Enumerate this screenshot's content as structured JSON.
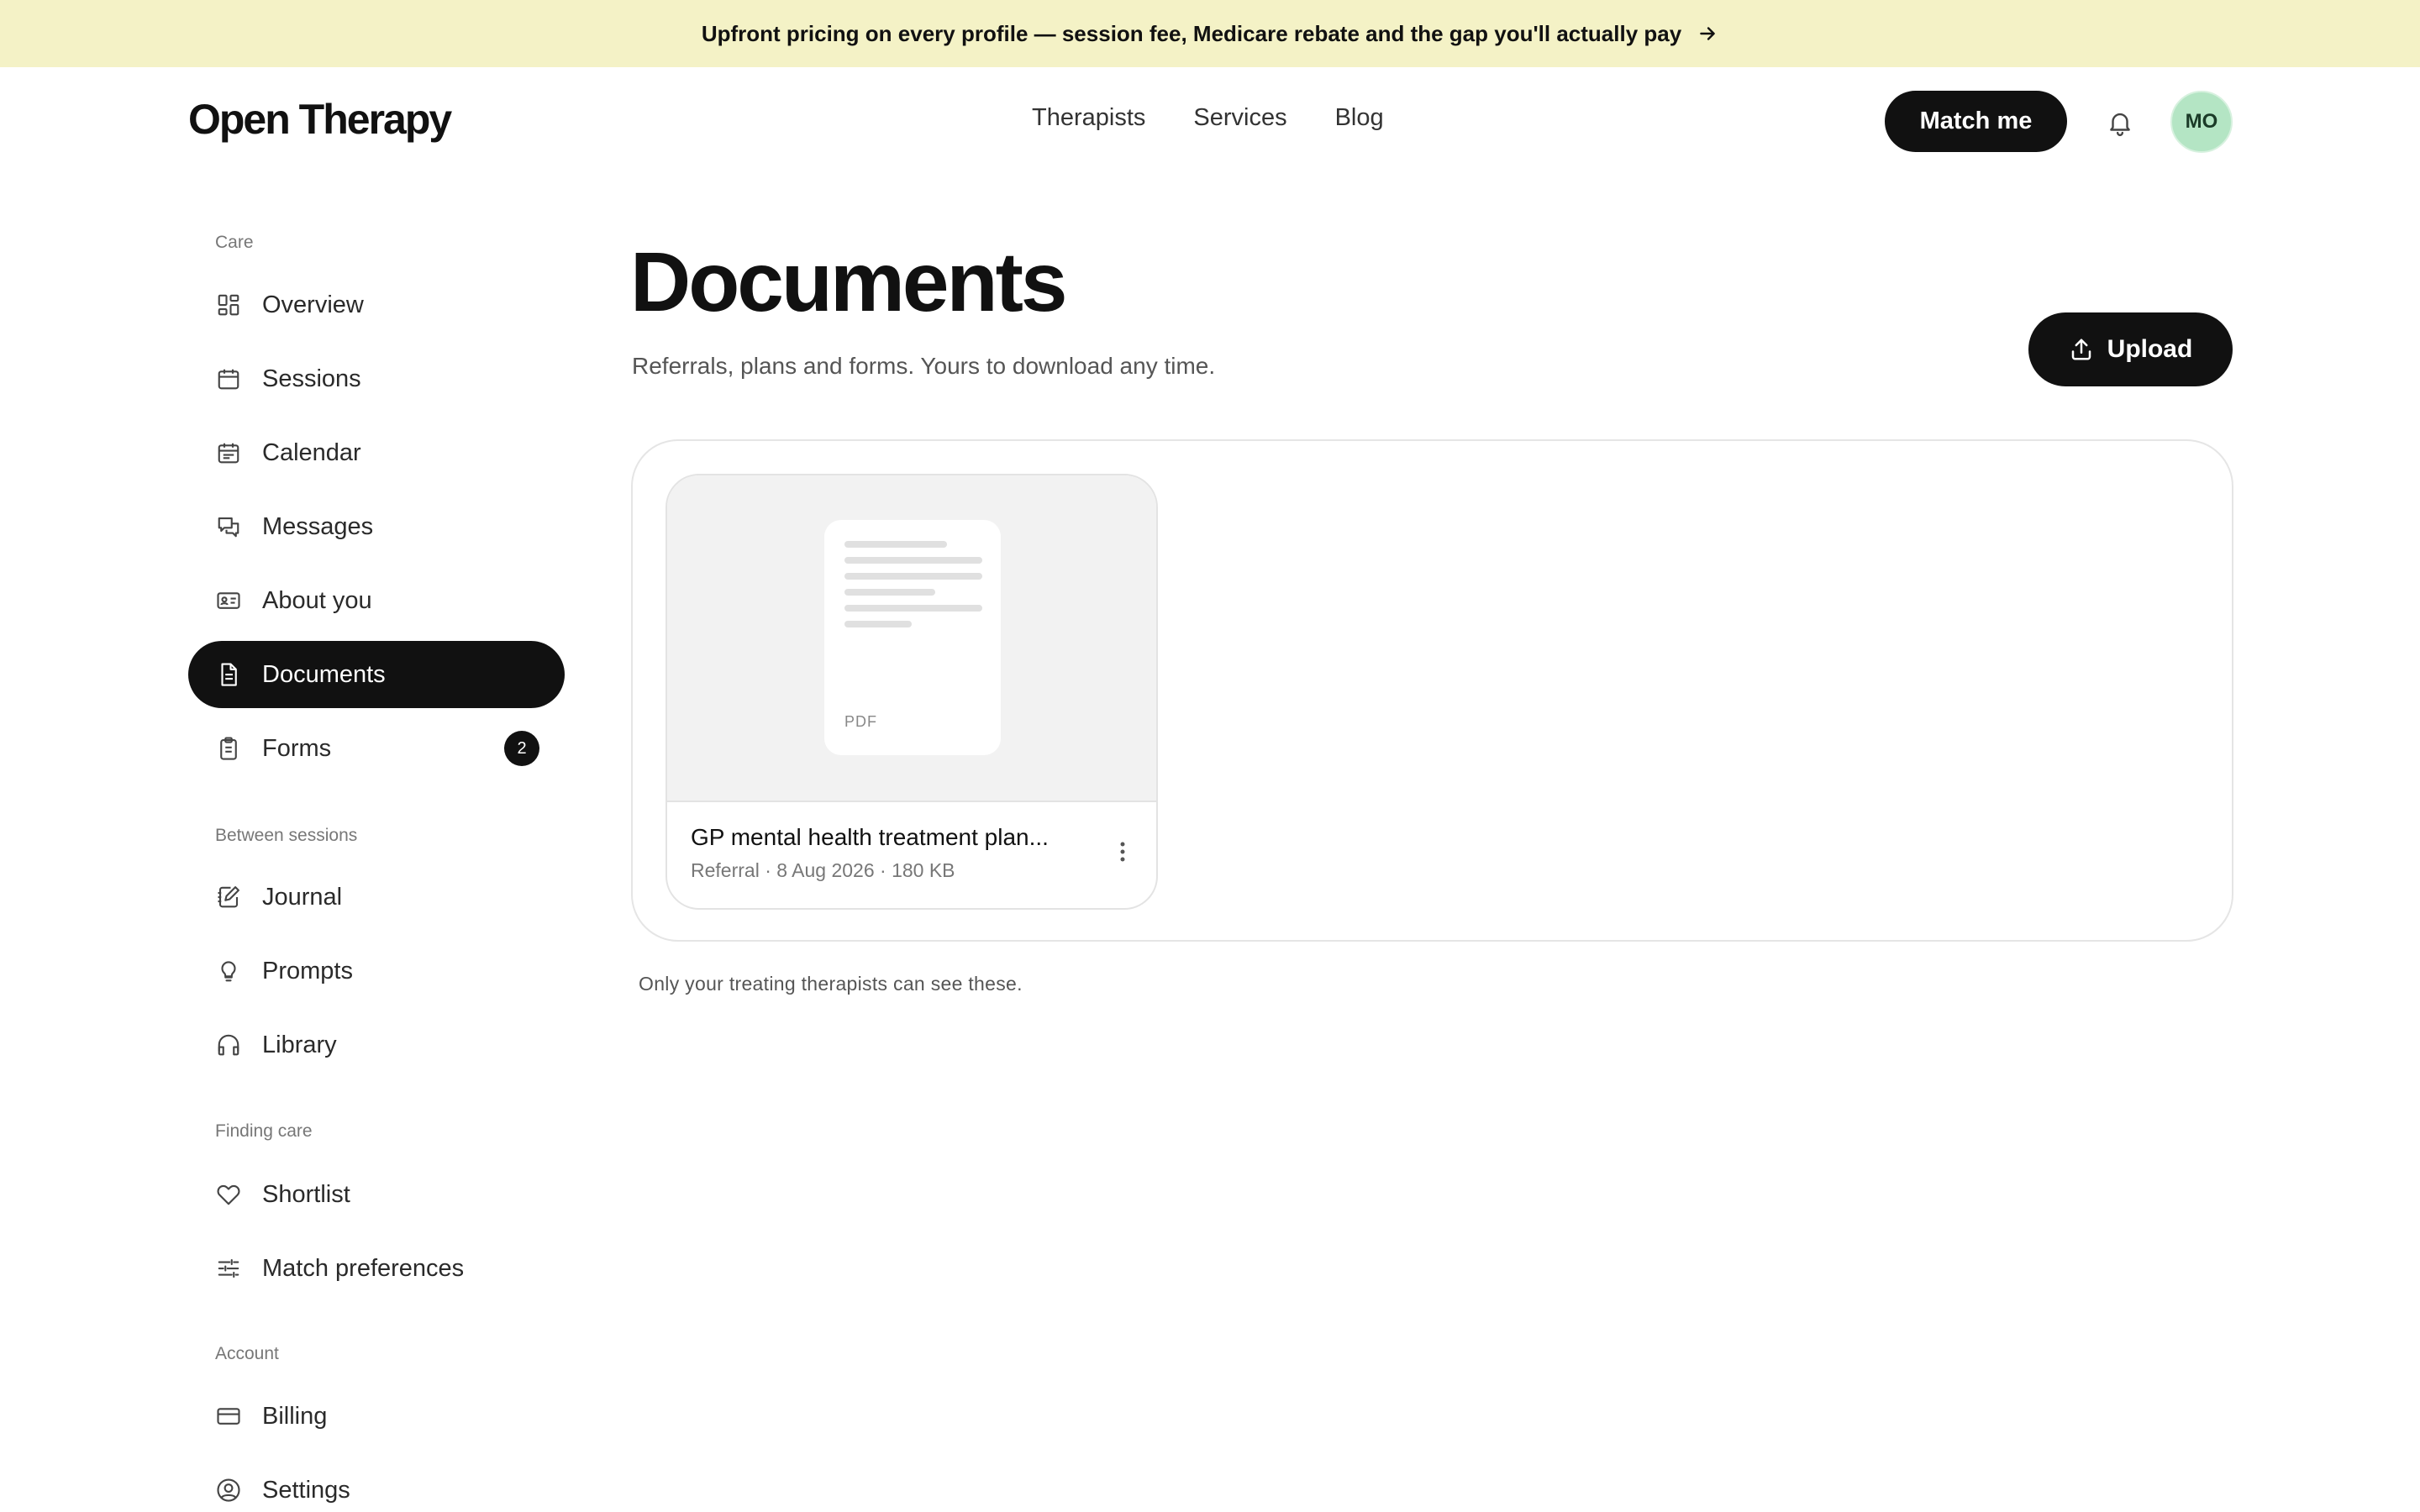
{
  "banner": {
    "text": "Upfront pricing on every profile — session fee, Medicare rebate and the gap you'll actually pay",
    "icon": "arrow-right-icon"
  },
  "header": {
    "logo": "Open Therapy",
    "nav": [
      "Therapists",
      "Services",
      "Blog"
    ],
    "match_label": "Match me",
    "avatar_initials": "MO",
    "avatar_color": "#b4e5c4"
  },
  "sidebar": {
    "care_label": "Care",
    "care_items": [
      {
        "label": "Overview",
        "icon": "grid-icon"
      },
      {
        "label": "Sessions",
        "icon": "calendar-grid-icon"
      },
      {
        "label": "Calendar",
        "icon": "calendar-icon"
      },
      {
        "label": "Messages",
        "icon": "chat-bubbles-icon"
      },
      {
        "label": "About you",
        "icon": "id-card-icon"
      },
      {
        "label": "Documents",
        "icon": "document-icon",
        "active": true
      },
      {
        "label": "Forms",
        "icon": "clipboard-icon",
        "badge": "2"
      }
    ],
    "between_label": "Between sessions",
    "between_items": [
      {
        "label": "Journal",
        "icon": "notebook-pen-icon"
      },
      {
        "label": "Prompts",
        "icon": "lightbulb-icon"
      },
      {
        "label": "Library",
        "icon": "headphones-icon"
      }
    ],
    "finding_label": "Finding care",
    "finding_items": [
      {
        "label": "Shortlist",
        "icon": "heart-icon"
      },
      {
        "label": "Match preferences",
        "icon": "sliders-icon"
      }
    ],
    "account_label": "Account",
    "account_items": [
      {
        "label": "Billing",
        "icon": "credit-card-icon"
      },
      {
        "label": "Settings",
        "icon": "user-circle-icon"
      }
    ]
  },
  "main": {
    "title": "Documents",
    "subtitle": "Referrals, plans and forms. Yours to download any time.",
    "upload_label": "Upload",
    "documents": [
      {
        "name": "GP mental health treatment plan...",
        "type": "PDF",
        "meta": "Referral · 8 Aug 2026 · 180 KB"
      }
    ],
    "footnote": "Only your treating therapists can see these."
  },
  "colors": {
    "banner_bg": "#f4f2c6",
    "primary": "#111111",
    "avatar": "#b4e5c4"
  }
}
